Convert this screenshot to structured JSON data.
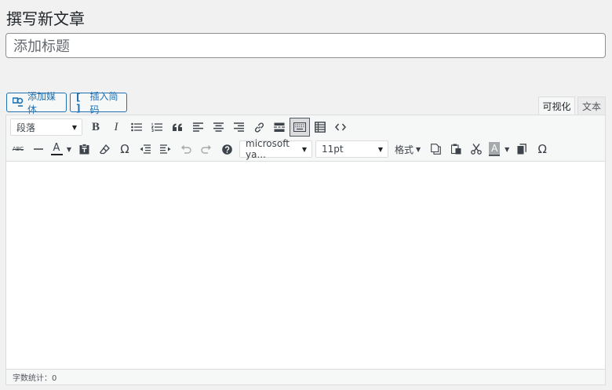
{
  "page": {
    "title": "撰写新文章"
  },
  "post": {
    "title_placeholder": "添加标题"
  },
  "media_buttons": {
    "add_media": "添加媒体",
    "insert_shortcode": "插入简码"
  },
  "editor_tabs": {
    "visual": "可视化",
    "text": "文本",
    "active": "visual"
  },
  "toolbar": {
    "paragraph_select": "段落",
    "font_family": "microsoft ya...",
    "font_size": "11pt",
    "formats_menu": "格式",
    "bold": "B",
    "italic": "I",
    "text_color_letter": "A",
    "bg_color_letter": "A",
    "strikethrough": "ABC",
    "omega": "Ω"
  },
  "status": {
    "word_count_label": "字数统计：0"
  },
  "colors": {
    "accent": "#2271b1",
    "toolbar_bg": "#f6f7f7",
    "border": "#dcdcde"
  }
}
